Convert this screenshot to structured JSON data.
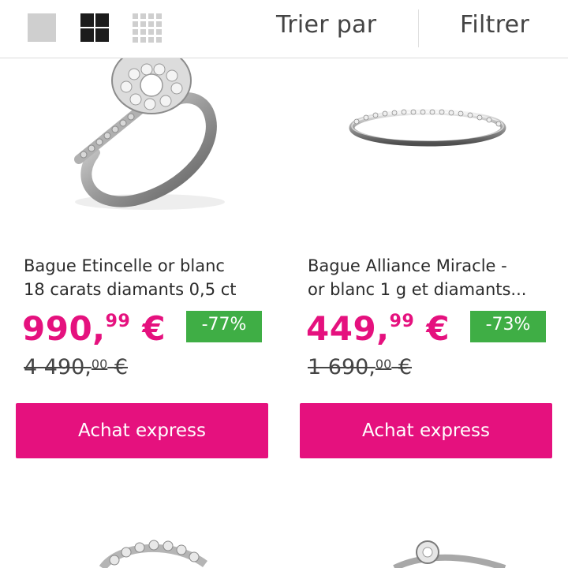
{
  "toolbar": {
    "view_icons": [
      "single-view-icon",
      "grid-view-icon",
      "compact-grid-view-icon"
    ],
    "sort_label": "Trier par",
    "filter_label": "Filtrer"
  },
  "products": [
    {
      "title_line1": "Bague Etincelle or blanc",
      "title_line2": "18 carats diamants 0,5 ct",
      "price_main": "990,",
      "price_cents": "99",
      "price_currency": " €",
      "discount": "-77%",
      "old_price_main": "4 490,",
      "old_price_cents": "00",
      "old_price_currency": " €",
      "button_label": "Achat express"
    },
    {
      "title_line1": "Bague Alliance Miracle -",
      "title_line2": "or blanc 1 g et diamants...",
      "price_main": "449,",
      "price_cents": "99",
      "price_currency": " €",
      "discount": "-73%",
      "old_price_main": "1 690,",
      "old_price_cents": "00",
      "old_price_currency": " €",
      "button_label": "Achat express"
    }
  ],
  "colors": {
    "accent": "#e5117e",
    "discount_badge": "#3fae45",
    "divider": "#dcdcdc"
  }
}
